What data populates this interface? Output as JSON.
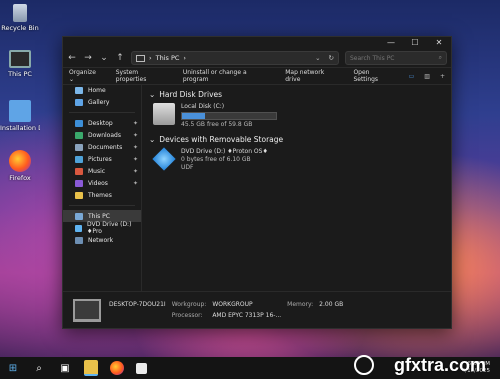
{
  "desktop": {
    "icons": [
      {
        "label": "Recycle Bin"
      },
      {
        "label": "This PC"
      },
      {
        "label": "Installation D..."
      },
      {
        "label": "Firefox"
      }
    ]
  },
  "window": {
    "controls": {
      "minimize": "—",
      "maximize": "☐",
      "close": "✕"
    },
    "address": {
      "path": "This PC",
      "separator": "›"
    },
    "search": {
      "placeholder": "Search This PC"
    },
    "toolbar": {
      "organize": "Organize ⌄",
      "system_properties": "System properties",
      "uninstall": "Uninstall or change a program",
      "map_drive": "Map network drive",
      "open_settings": "Open Settings"
    },
    "sidebar": {
      "top": [
        {
          "label": "Home"
        },
        {
          "label": "Gallery"
        }
      ],
      "pinned": [
        {
          "label": "Desktop"
        },
        {
          "label": "Downloads"
        },
        {
          "label": "Documents"
        },
        {
          "label": "Pictures"
        },
        {
          "label": "Music"
        },
        {
          "label": "Videos"
        },
        {
          "label": "Themes"
        }
      ],
      "bottom": [
        {
          "label": "This PC"
        },
        {
          "label": "DVD Drive (D:) ♦Pro"
        },
        {
          "label": "Network"
        }
      ]
    },
    "groups": {
      "hard_disks": {
        "title": "Hard Disk Drives",
        "drive": {
          "name": "Local Disk (C:)",
          "free_text": "45.5 GB free of 59.8 GB",
          "used_fraction": 0.24
        }
      },
      "removable": {
        "title": "Devices with Removable Storage",
        "drive": {
          "name": "DVD Drive (D:) ♦Proton OS♦",
          "free_text": "0 bytes free of 6.10 GB",
          "fs": "UDF"
        }
      }
    },
    "details": {
      "computer_name": "DESKTOP-7DOU21I",
      "workgroup_label": "Workgroup:",
      "workgroup": "WORKGROUP",
      "memory_label": "Memory:",
      "memory": "2.00 GB",
      "processor_label": "Processor:",
      "processor": "AMD EPYC 7313P 16-..."
    }
  },
  "taskbar": {
    "time": "5:37 PM",
    "date": "4/18/2025"
  },
  "watermark": {
    "text": "gfxtra.com"
  }
}
